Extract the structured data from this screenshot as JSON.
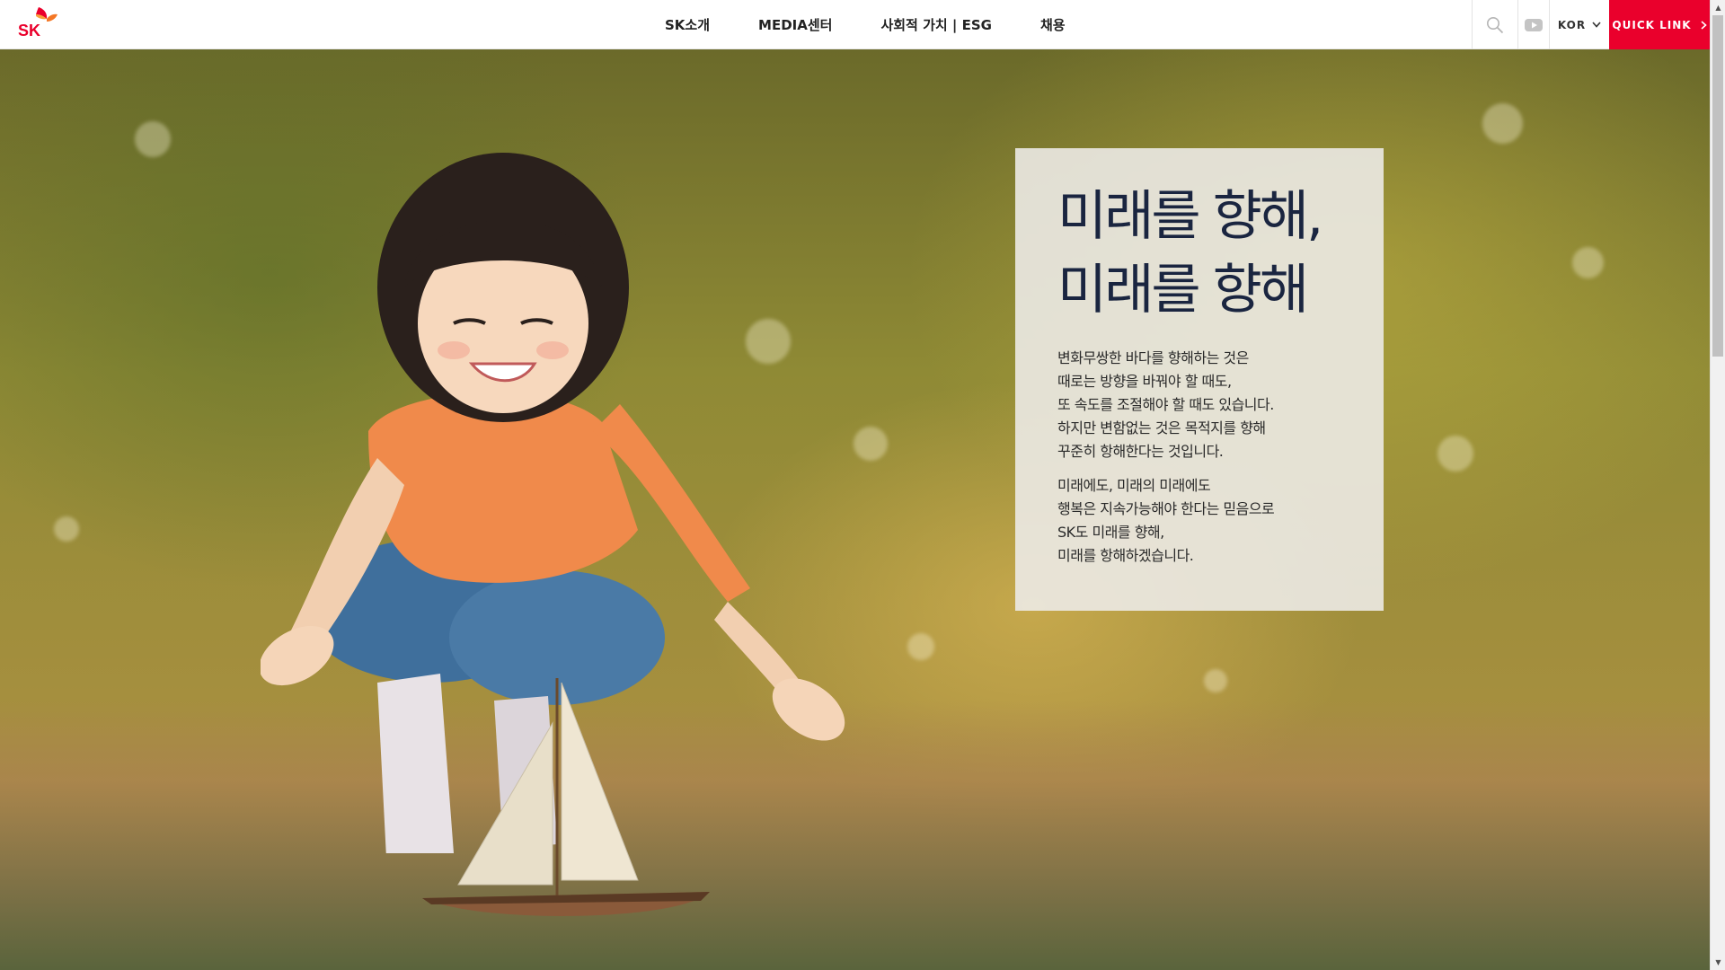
{
  "brand": {
    "logo_text": "SK",
    "logo_accent_colors": [
      "#ea002c",
      "#f47725"
    ]
  },
  "nav": {
    "items": [
      {
        "label": "SK소개"
      },
      {
        "label": "MEDIA센터"
      },
      {
        "label": "사회적 가치 | ESG"
      },
      {
        "label": "채용"
      }
    ]
  },
  "utility": {
    "search_icon": "search-icon",
    "youtube_icon": "youtube-icon",
    "language": "KOR",
    "quick_link": "QUICK LINK",
    "quick_link_color": "#ea002c"
  },
  "hero": {
    "title_line1": "미래를 향해,",
    "title_line2": "미래를 향해",
    "paragraph1": [
      "변화무쌍한 바다를 향해하는 것은",
      "때로는 방향을 바꿔야 할 때도,",
      "또 속도를 조절해야 할 때도 있습니다.",
      "하지만 변함없는 것은 목적지를 향해",
      "꾸준히 항해한다는 것입니다."
    ],
    "paragraph2": [
      "미래에도, 미래의 미래에도",
      "행복은 지속가능해야 한다는 믿음으로",
      "SK도 미래를 향해,",
      "미래를 항해하겠습니다."
    ]
  }
}
